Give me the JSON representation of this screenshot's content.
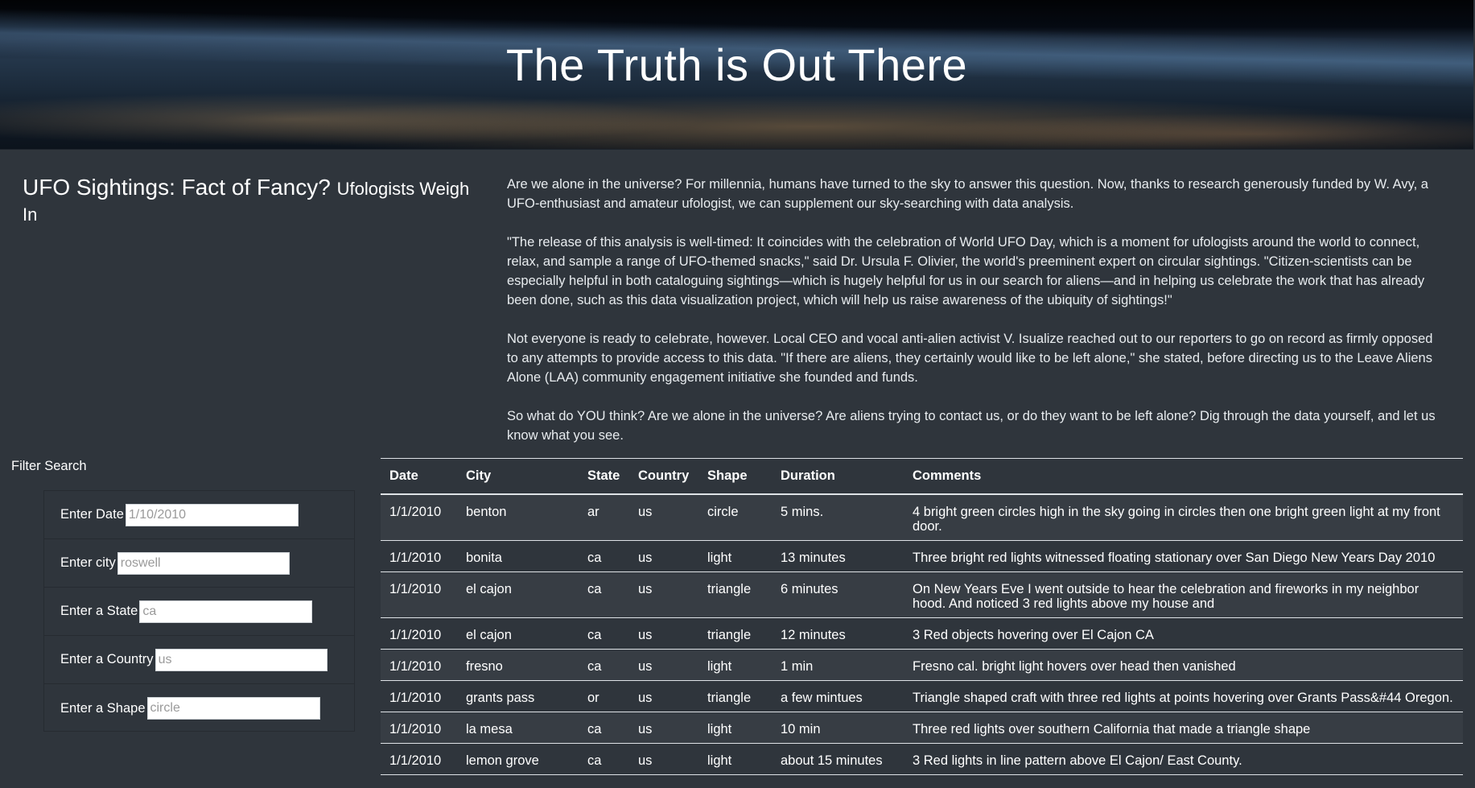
{
  "header": {
    "title": "The Truth is Out There"
  },
  "article": {
    "title_main": "UFO Sightings: Fact of Fancy?",
    "title_sub": "Ufologists Weigh In",
    "paragraphs": [
      "Are we alone in the universe? For millennia, humans have turned to the sky to answer this question. Now, thanks to research generously funded by W. Avy, a UFO-enthusiast and amateur ufologist, we can supplement our sky-searching with data analysis.",
      "\"The release of this analysis is well-timed: It coincides with the celebration of World UFO Day, which is a moment for ufologists around the world to connect, relax, and sample a range of UFO-themed snacks,\" said Dr. Ursula F. Olivier, the world's preeminent expert on circular sightings. \"Citizen-scientists can be especially helpful in both cataloguing sightings—which is hugely helpful for us in our search for aliens—and in helping us celebrate the work that has already been done, such as this data visualization project, which will help us raise awareness of the ubiquity of sightings!\"",
      "Not everyone is ready to celebrate, however. Local CEO and vocal anti-alien activist V. Isualize reached out to our reporters to go on record as firmly opposed to any attempts to provide access to this data. \"If there are aliens, they certainly would like to be left alone,\" she stated, before directing us to the Leave Aliens Alone (LAA) community engagement initiative she founded and funds.",
      "So what do YOU think? Are we alone in the universe? Are aliens trying to contact us, or do they want to be left alone? Dig through the data yourself, and let us know what you see."
    ]
  },
  "filters": {
    "heading": "Filter Search",
    "date": {
      "label": "Enter Date",
      "placeholder": "1/10/2010"
    },
    "city": {
      "label": "Enter city",
      "placeholder": "roswell"
    },
    "state": {
      "label": "Enter a State",
      "placeholder": "ca"
    },
    "country": {
      "label": "Enter a Country",
      "placeholder": "us"
    },
    "shape": {
      "label": "Enter a Shape",
      "placeholder": "circle"
    }
  },
  "table": {
    "headers": [
      "Date",
      "City",
      "State",
      "Country",
      "Shape",
      "Duration",
      "Comments"
    ],
    "rows": [
      [
        "1/1/2010",
        "benton",
        "ar",
        "us",
        "circle",
        "5 mins.",
        "4 bright green circles high in the sky going in circles then one bright green light at my front door."
      ],
      [
        "1/1/2010",
        "bonita",
        "ca",
        "us",
        "light",
        "13 minutes",
        "Three bright red lights witnessed floating stationary over San Diego New Years Day 2010"
      ],
      [
        "1/1/2010",
        "el cajon",
        "ca",
        "us",
        "triangle",
        "6 minutes",
        "On New Years Eve I went outside to hear the celebration and fireworks in my neighbor hood. And noticed 3 red lights above my house and"
      ],
      [
        "1/1/2010",
        "el cajon",
        "ca",
        "us",
        "triangle",
        "12 minutes",
        "3 Red objects hovering over El Cajon CA"
      ],
      [
        "1/1/2010",
        "fresno",
        "ca",
        "us",
        "light",
        "1 min",
        "Fresno cal. bright light hovers over head then vanished"
      ],
      [
        "1/1/2010",
        "grants pass",
        "or",
        "us",
        "triangle",
        "a few mintues",
        "Triangle shaped craft with three red lights at points hovering over Grants Pass&#44 Oregon."
      ],
      [
        "1/1/2010",
        "la mesa",
        "ca",
        "us",
        "light",
        "10 min",
        "Three red lights over southern California that made a triangle shape"
      ],
      [
        "1/1/2010",
        "lemon grove",
        "ca",
        "us",
        "light",
        "about 15 minutes",
        "3 Red lights in line pattern above El Cajon/ East County."
      ]
    ]
  }
}
